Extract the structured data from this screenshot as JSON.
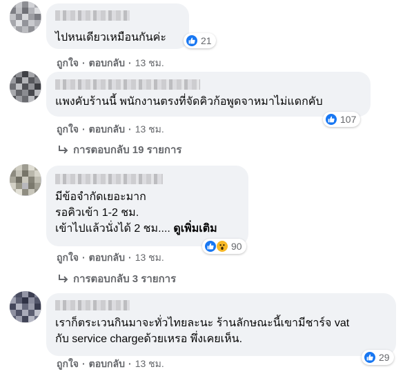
{
  "comments": [
    {
      "text_lines": [
        "ไปหนเดียวเหมือนกันค่ะ"
      ],
      "reaction_count": "21",
      "reactions": [
        "like-icon"
      ],
      "actions": {
        "like": "ถูกใจ",
        "reply": "ตอบกลับ",
        "time": "13 ชม."
      }
    },
    {
      "text_lines": [
        "แพงคับร้านนี้ พนักงานตรงที่จัดคิวก้อพูดจาหมาไม่แดกคับ"
      ],
      "reaction_count": "107",
      "reactions": [
        "like-icon"
      ],
      "actions": {
        "like": "ถูกใจ",
        "reply": "ตอบกลับ",
        "time": "13 ชม."
      },
      "replies_label": "การตอบกลับ 19 รายการ"
    },
    {
      "text_lines": [
        "มีข้อจำกัดเยอะมาก",
        "รอคิวเข้า 1-2 ชม.",
        "เข้าไปแล้วนั่งได้ 2 ชม...."
      ],
      "see_more": "ดูเพิ่มเติม",
      "reaction_count": "90",
      "reactions": [
        "like-icon",
        "wow-icon"
      ],
      "actions": {
        "like": "ถูกใจ",
        "reply": "ตอบกลับ",
        "time": "13 ชม."
      },
      "replies_label": "การตอบกลับ 3 รายการ"
    },
    {
      "text_lines": [
        "เราก็ตระเวนกินมาจะทั่วไทยละนะ ร้านลักษณะนี้เขามีชาร์จ vat",
        "กับ service chargeด้วยเหรอ พึ่งเคยเห็น."
      ],
      "reaction_count": "29",
      "reactions": [
        "like-icon"
      ],
      "actions": {
        "like": "ถูกใจ",
        "reply": "ตอบกลับ",
        "time": "13 ชม."
      }
    }
  ],
  "colors": {
    "bubble": "#f0f2f5",
    "like_blue": "#1877f2",
    "wow_yellow": "#f7b928",
    "meta_gray": "#65676b"
  }
}
